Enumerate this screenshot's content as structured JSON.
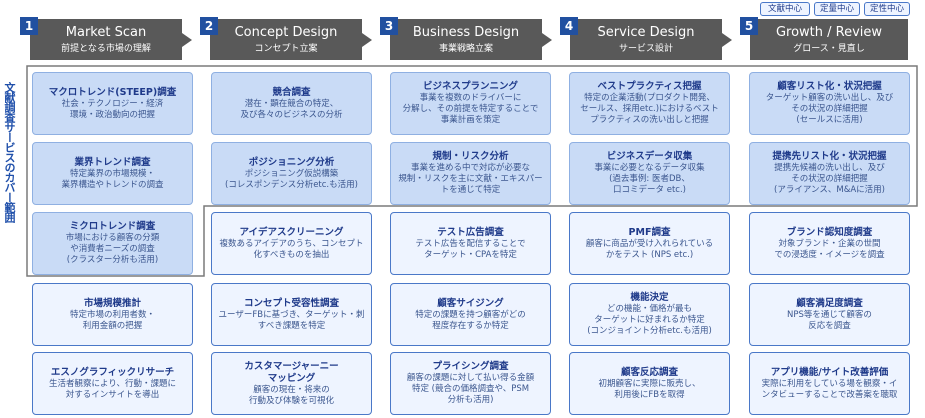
{
  "legend": [
    "文献中心",
    "定量中心",
    "定性中心"
  ],
  "side_label": "文献調査サービスのカバー範囲",
  "phases": [
    {
      "num": "1",
      "title": "Market Scan",
      "subtitle": "前提となる市場の理解"
    },
    {
      "num": "2",
      "title": "Concept Design",
      "subtitle": "コンセプト立案"
    },
    {
      "num": "3",
      "title": "Business Design",
      "subtitle": "事業戦略立案"
    },
    {
      "num": "4",
      "title": "Service Design",
      "subtitle": "サービス設計"
    },
    {
      "num": "5",
      "title": "Growth / Review",
      "subtitle": "グロース・見直し"
    }
  ],
  "columns": [
    [
      {
        "title": "マクロトレンド(STEEP)調査",
        "desc": "社会・テクノロジー・経済\n環境・政治動向の把握"
      },
      {
        "title": "業界トレンド調査",
        "desc": "特定業界の市場規模・\n業界構造やトレンドの調査"
      },
      {
        "title": "ミクロトレンド調査",
        "desc": "市場における顧客の分類\nや消費者ニーズの調査\n(クラスター分析も活用)"
      },
      {
        "title": "市場規模推計",
        "desc": "特定市場の利用者数・\n利用金額の把握"
      },
      {
        "title": "エスノグラフィックリサーチ",
        "desc": "生活者観察により、行動・課題に\n対するインサイトを導出"
      }
    ],
    [
      {
        "title": "競合調査",
        "desc": "潜在・顕在競合の特定、\n及び各々のビジネスの分析"
      },
      {
        "title": "ポジショニング分析",
        "desc": "ポジショニング仮説構築\n(コレスポンデンス分析etc.も活用)"
      },
      {
        "title": "アイデアスクリーニング",
        "desc": "複数あるアイデアのうち、コンセプト\n化すべきものを抽出"
      },
      {
        "title": "コンセプト受容性調査",
        "desc": "ユーザーFBに基づき、ターゲット・刺\nすべき課題を特定"
      },
      {
        "title": "カスタマージャーニー\nマッピング",
        "desc": "顧客の現在・将来の\n行動及び体験を可視化"
      }
    ],
    [
      {
        "title": "ビジネスプランニング",
        "desc": "事業を複数のドライバーに\n分解し、その前提を特定することで\n事業計画を策定"
      },
      {
        "title": "規制・リスク分析",
        "desc": "事業を進める中で対応が必要な\n規制・リスクを主に文献・エキスパー\nトを通じて特定"
      },
      {
        "title": "テスト広告調査",
        "desc": "テスト広告を配信することで\nターゲット・CPAを特定"
      },
      {
        "title": "顧客サイジング",
        "desc": "特定の課題を持つ顧客がどの\n程度存在するか特定"
      },
      {
        "title": "プライシング調査",
        "desc": "顧客の課題に対して払い得る金額\n特定 (競合の価格調査や、PSM\n分析も活用)"
      }
    ],
    [
      {
        "title": "ベストプラクティス把握",
        "desc": "特定の企業活動(プロダクト開発、\nセールス、採用etc.)におけるベスト\nプラクティスの洗い出しと把握"
      },
      {
        "title": "ビジネスデータ収集",
        "desc": "事業に必要となるデータ収集\n(過去事例: 医者DB、\n口コミデータ etc.)"
      },
      {
        "title": "PMF調査",
        "desc": "顧客に商品が受け入れられている\nかをテスト (NPS etc.)"
      },
      {
        "title": "機能決定",
        "desc": "どの機能・価格が最も\nターゲットに好まれるか特定\n(コンジョイント分析etc.も活用)"
      },
      {
        "title": "顧客反応調査",
        "desc": "初期顧客に実際に販売し、\n利用後にFBを取得"
      }
    ],
    [
      {
        "title": "顧客リスト化・状況把握",
        "desc": "ターゲット顧客の洗い出し、及び\nその状況の詳細把握\n(セールスに活用)"
      },
      {
        "title": "提携先リスト化・状況把握",
        "desc": "提携先候補の洗い出し、及び\nその状況の詳細把握\n(アライアンス、M&Aに活用)"
      },
      {
        "title": "ブランド認知度調査",
        "desc": "対象ブランド・企業の世間\nでの浸透度・イメージを調査"
      },
      {
        "title": "顧客満足度調査",
        "desc": "NPS等を通じて顧客の\n反応を調査"
      },
      {
        "title": "アプリ機能/サイト改善評価",
        "desc": "実際に利用をしている場を観察・イ\nンタビューすることで改善案を聴取"
      }
    ]
  ],
  "colors": {
    "header": "#595959",
    "badge": "#2150a0",
    "card_border": "#4a78c8",
    "card_fill": "#eef4ff",
    "coverage_fill": "#c9dbf6",
    "coverage_line": "#7a7a7a"
  }
}
